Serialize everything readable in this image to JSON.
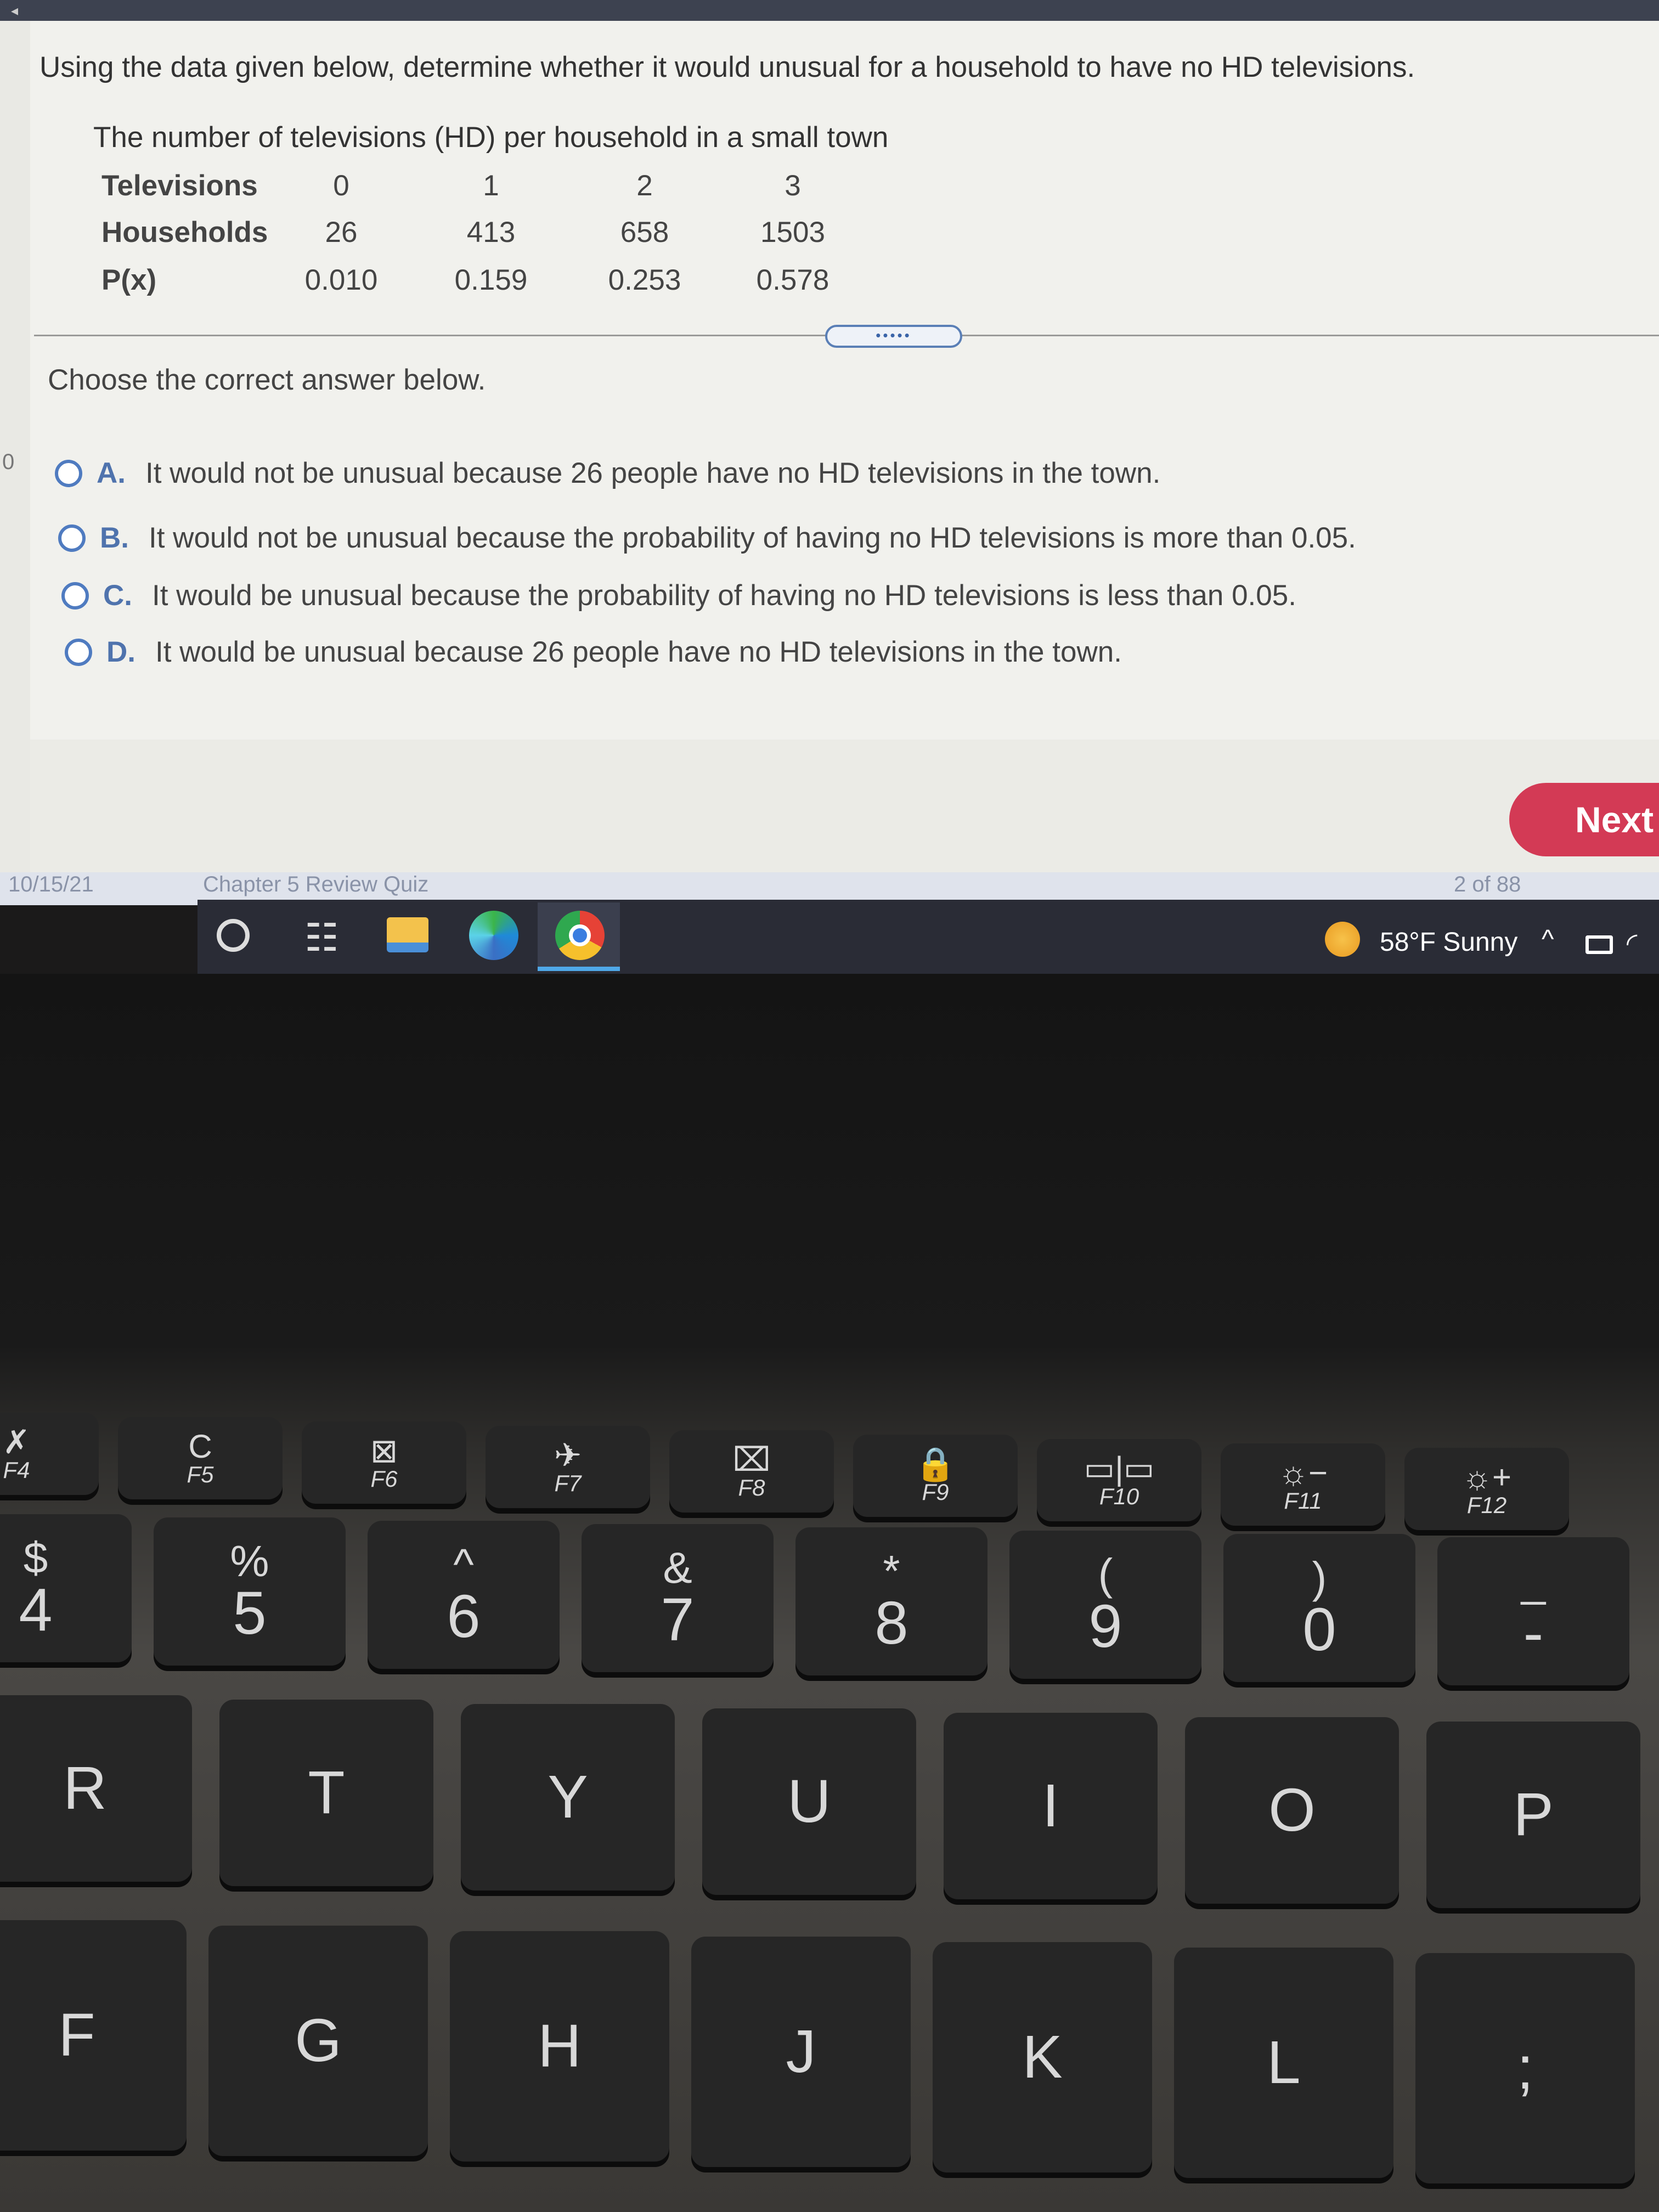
{
  "question": "Using the data given below, determine whether it would unusual for a household to have no HD televisions.",
  "table": {
    "title": "The number of televisions (HD) per household in a small town",
    "rows": [
      {
        "label": "Televisions",
        "values": [
          "0",
          "1",
          "2",
          "3"
        ]
      },
      {
        "label": "Households",
        "values": [
          "26",
          "413",
          "658",
          "1503"
        ]
      },
      {
        "label": "P(x)",
        "values": [
          "0.010",
          "0.159",
          "0.253",
          "0.578"
        ]
      }
    ]
  },
  "handle": "•••••",
  "instruction": "Choose the correct answer below.",
  "options": [
    {
      "letter": "A.",
      "text": "It would not be unusual because 26 people have no HD televisions in the town."
    },
    {
      "letter": "B.",
      "text": "It would not be unusual because the probability of having no HD televisions is more than 0.05."
    },
    {
      "letter": "C.",
      "text": "It would be unusual because the probability of having no HD televisions is less than 0.05."
    },
    {
      "letter": "D.",
      "text": "It would be unusual because 26 people have no HD televisions in the town."
    }
  ],
  "next_label": "Next",
  "background_tab": {
    "date": "10/15/21",
    "title": "Chapter 5 Review Quiz",
    "count": "2 of 88"
  },
  "taskbar": {
    "weather": "58°F  Sunny",
    "icons": [
      "search-icon",
      "task-view-icon",
      "file-explorer-icon",
      "edge-icon",
      "chrome-icon"
    ]
  },
  "keyboard": {
    "fn_row": [
      {
        "icon": "✗",
        "label": "F4"
      },
      {
        "icon": "C",
        "label": "F5"
      },
      {
        "icon": "⊠",
        "label": "F6"
      },
      {
        "icon": "✈",
        "label": "F7"
      },
      {
        "icon": "⌧",
        "label": "F8"
      },
      {
        "icon": "🔒",
        "label": "F9"
      },
      {
        "icon": "▭|▭",
        "label": "F10"
      },
      {
        "icon": "☼−",
        "label": "F11"
      },
      {
        "icon": "☼+",
        "label": "F12"
      }
    ],
    "num_row": [
      {
        "top": "$",
        "main": "4"
      },
      {
        "top": "%",
        "main": "5"
      },
      {
        "top": "^",
        "main": "6"
      },
      {
        "top": "&",
        "main": "7"
      },
      {
        "top": "*",
        "main": "8"
      },
      {
        "top": "(",
        "main": "9"
      },
      {
        "top": ")",
        "main": "0"
      },
      {
        "top": "_",
        "main": "-"
      }
    ],
    "row_r": [
      "R",
      "T",
      "Y",
      "U",
      "I",
      "O",
      "P"
    ],
    "row_f": [
      "F",
      "G",
      "H",
      "J",
      "K",
      "L",
      ";"
    ]
  }
}
